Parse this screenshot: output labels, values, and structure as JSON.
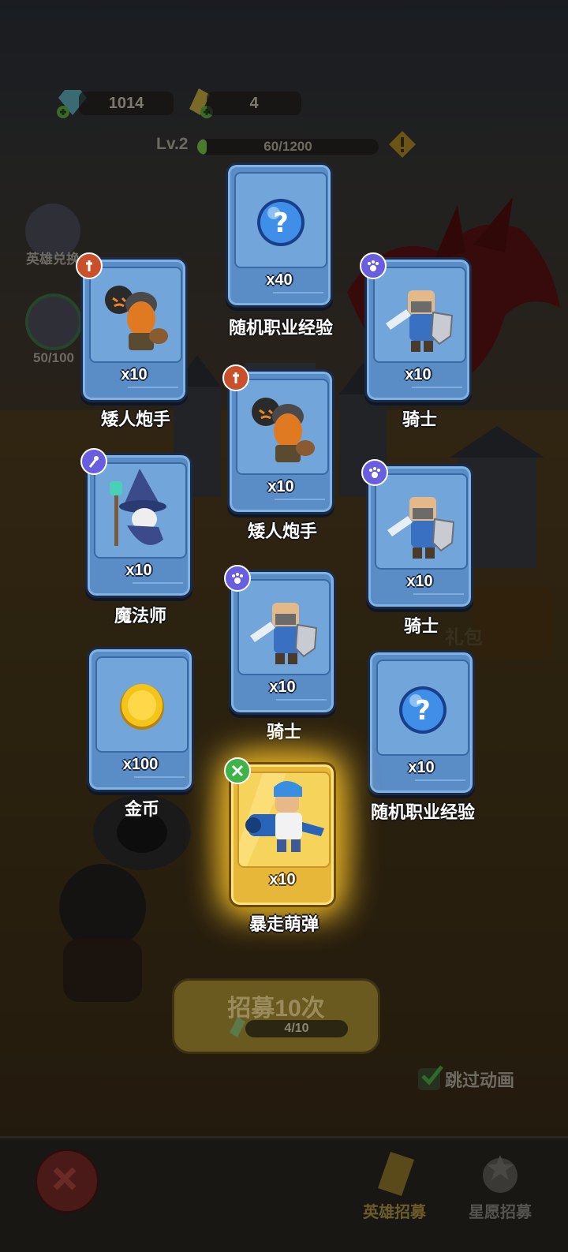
{
  "hud": {
    "gems": "1014",
    "tickets": "4",
    "level": "Lv.2",
    "xp_text": "60/1200",
    "xp_progress": 0.05
  },
  "side": {
    "hero_exchange_label": "英雄兑换",
    "progress_label": "50/100"
  },
  "cards": [
    {
      "qty": "x40",
      "name": "随机职业经验",
      "icon": "question-orb-icon"
    },
    {
      "qty": "x10",
      "name": "矮人炮手",
      "icon": "dwarf-gunner",
      "badge": "fire-class-icon"
    },
    {
      "qty": "x10",
      "name": "骑士",
      "icon": "knight",
      "badge": "paw-class-icon"
    },
    {
      "qty": "x10",
      "name": "矮人炮手",
      "icon": "dwarf-gunner",
      "badge": "fire-class-icon"
    },
    {
      "qty": "x10",
      "name": "魔法师",
      "icon": "wizard",
      "badge": "staff-class-icon"
    },
    {
      "qty": "x10",
      "name": "骑士",
      "icon": "knight",
      "badge": "paw-class-icon"
    },
    {
      "qty": "x10",
      "name": "骑士",
      "icon": "knight",
      "badge": "paw-class-icon"
    },
    {
      "qty": "x100",
      "name": "金币",
      "icon": "gold-coin-icon"
    },
    {
      "qty": "x10",
      "name": "随机职业经验",
      "icon": "question-orb-icon"
    },
    {
      "qty": "x10",
      "name": "暴走萌弹",
      "icon": "cannon-hero",
      "badge": "crossed-swords-icon",
      "rarity": "gold"
    }
  ],
  "recruit": {
    "label": "招募10次",
    "count": "4/10"
  },
  "skip": {
    "label": "跳过动画",
    "checked": true
  },
  "tabs": {
    "hero_recruit": "英雄招募",
    "star_recruit": "星愿招募"
  },
  "bg_sign": "礼包",
  "colors": {
    "card_blue": "#5a8cc6",
    "card_gold": "#e7b73a",
    "badge_fire": "#c8502a",
    "badge_purple": "#6a5ee0"
  }
}
